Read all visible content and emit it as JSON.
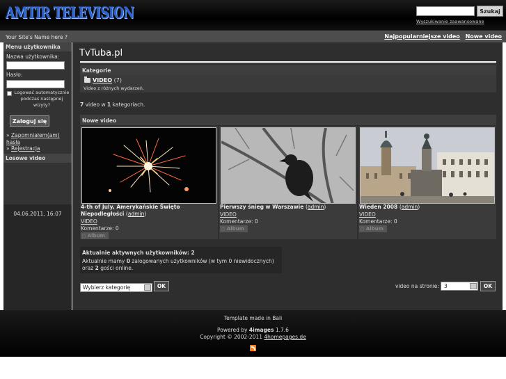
{
  "header": {
    "logo_text": "AMTIR TELEVISION",
    "search_button": "Szukaj",
    "advanced_search": "Wyszukiwanie zaawansowane"
  },
  "topbar": {
    "site_name": "Your Site's Name here ?",
    "links": [
      "Najpopularniejsze video",
      "Nowe video"
    ]
  },
  "sidebar": {
    "user_menu_title": "Menu użytkownika",
    "username_label": "Nazwa użytkownika:",
    "password_label": "Hasło:",
    "remember_text": "Logować automatycznie podczas następnej wizyty?",
    "login_button": "Zaloguj się",
    "forgot_link": "Zapomniałem(am) hasła",
    "register_link": "Rejestracja",
    "random_title": "Losowe video",
    "date": "04.06.2011, 16:07"
  },
  "main": {
    "title": "TvTuba.pl",
    "categories_title": "Kategorie",
    "category": {
      "name": "VIDEO",
      "count": "(7)",
      "description": "Video z różnych wydarzeń."
    },
    "stats": {
      "videos": "7",
      "text_mid": "video w",
      "categories": "1",
      "text_end": "kategoriach."
    },
    "new_title": "Nowe video",
    "thumbs": [
      {
        "title": "4-th of July, Amerykańskie Święto Niepodległości",
        "author": "admin",
        "category": "VIDEO",
        "comments": "Komentarze: 0",
        "album": "Album"
      },
      {
        "title": "Pierwszy śnieg w Warszawie",
        "author": "admin",
        "category": "VIDEO",
        "comments": "Komentarze: 0",
        "album": "Album"
      },
      {
        "title": "Wieden 2008",
        "author": "admin",
        "category": "VIDEO",
        "comments": "Komentarze: 0",
        "album": "Album"
      }
    ],
    "users": {
      "title": "Aktualnie aktywnych użytkowników: 2",
      "t1": "Aktualnie mamy ",
      "registered": "0",
      "t2": " zalogowanych użytkowników (w tym 0 niewidocznych) oraz ",
      "guests": "2",
      "t3": " gości online."
    },
    "category_select": "Wybierz kategorię",
    "ok": "OK",
    "per_page_label": "video na stronie:",
    "per_page_value": "3"
  },
  "footer": {
    "template": "Template made in Bali",
    "powered_prefix": "Powered by",
    "powered_name": "4images",
    "powered_version": "1.7.6",
    "copyright": "Copyright © 2002-2011",
    "copyright_link": "4homepages.de"
  }
}
